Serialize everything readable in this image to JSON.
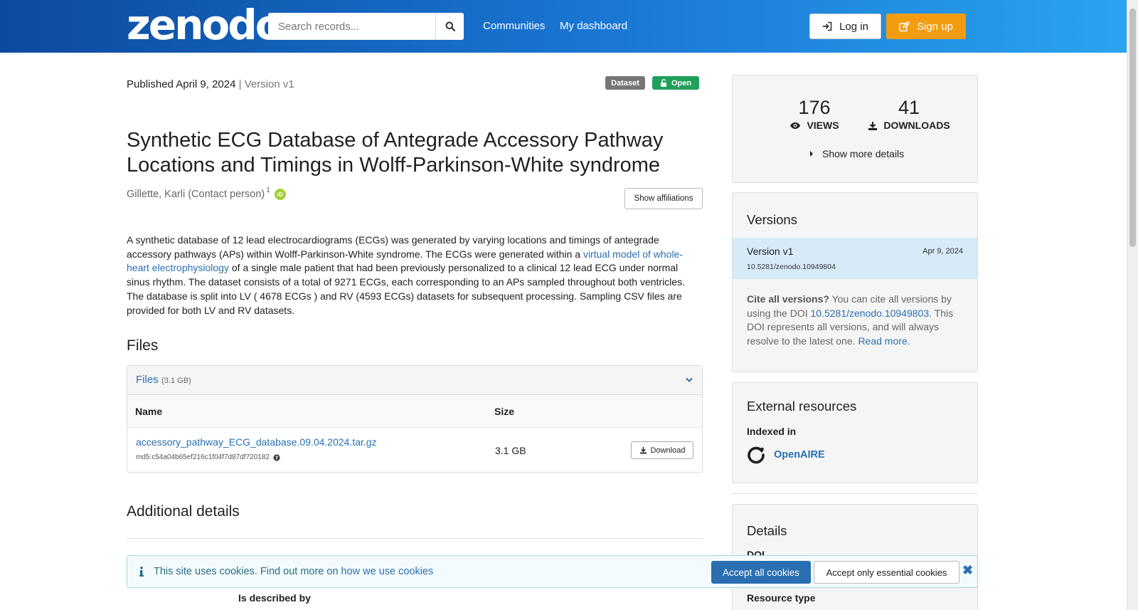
{
  "header": {
    "logo": "zenodo",
    "search_placeholder": "Search records...",
    "nav": [
      "Communities",
      "My dashboard"
    ],
    "login": "Log in",
    "signup": "Sign up"
  },
  "record": {
    "published": "Published April 9, 2024",
    "version": "| Version v1",
    "badge_type": "Dataset",
    "badge_access": "Open",
    "title": "Synthetic ECG Database of Antegrade Accessory Pathway Locations and Timings in Wolff-Parkinson-White syndrome",
    "creator": "Gillette, Karli (Contact person)",
    "creator_sup": "1",
    "orcid_label": "iD",
    "show_affiliations": "Show affiliations",
    "description_part1": "A synthetic database of 12 lead electrocardiograms (ECGs) was generated by varying locations and timings of antegrade accessory pathways (APs) within Wolff-Parkinson-White syndrome. The ECGs were generated within a ",
    "description_link": "virtual model of whole-heart electrophysiology",
    "description_part2": " of a single male patient that had been previously personalized to a clinical 12 lead ECG under normal sinus rhythm. The dataset consists of a total of 9271 ECGs, each corresponding to an APs sampled throughout both ventricles. The database is split into LV ( 4678 ECGs ) and RV (4593 ECGs) datasets for subsequent processing. Sampling CSV files are provided for both LV and RV datasets."
  },
  "files": {
    "heading": "Files",
    "panel_title": "Files",
    "panel_size": "(3.1 GB)",
    "col_name": "Name",
    "col_size": "Size",
    "rows": [
      {
        "name": "accessory_pathway_ECG_database.09.04.2024.tar.gz",
        "md5": "md5:c54a04b65ef216c1f04f7d87df720182",
        "size": "3.1 GB",
        "download": "Download"
      }
    ]
  },
  "additional": {
    "heading": "Additional details",
    "is_described_by": "Is described by"
  },
  "stats": {
    "views": "176",
    "views_label": "VIEWS",
    "downloads": "41",
    "downloads_label": "DOWNLOADS",
    "more": "Show more details"
  },
  "versions": {
    "heading": "Versions",
    "current_name": "Version v1",
    "current_date": "Apr 9, 2024",
    "current_doi": "10.5281/zenodo.10949804",
    "cite_bold": "Cite all versions?",
    "cite_text1": " You can cite all versions by using the DOI ",
    "cite_doi": "10.5281/zenodo.10949803",
    "cite_text2": ". This DOI represents all versions, and will always resolve to the latest one. ",
    "read_more": "Read more."
  },
  "external": {
    "heading": "External resources",
    "indexed_in": "Indexed in",
    "openaire": "OpenAIRE"
  },
  "details": {
    "heading": "Details",
    "doi_label": "DOI",
    "resource_type": "Resource type"
  },
  "cookie": {
    "text": "This site uses cookies. Find out more on ",
    "link": "how we use cookies",
    "accept_all": "Accept all cookies",
    "accept_essential": "Accept only essential cookies"
  },
  "colors": {
    "header_start": "#0c4a9e",
    "header_end": "#2aa3ee",
    "signup": "#f39c12",
    "open_badge": "#21a05b",
    "link": "#2a6fb2"
  }
}
